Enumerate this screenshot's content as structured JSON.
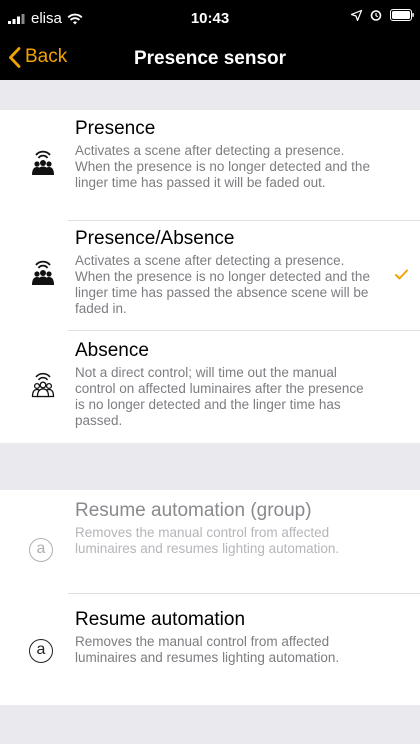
{
  "status_bar": {
    "carrier": "elisa",
    "time": "10:43"
  },
  "nav": {
    "back_label": "Back",
    "title": "Presence sensor"
  },
  "options": [
    {
      "title": "Presence",
      "description": "Activates a scene after detecting a presence. When the presence is no longer detected and the linger time has passed it will be faded out.",
      "icon": "presence-icon",
      "selected": false
    },
    {
      "title": "Presence/Absence",
      "description": "Activates a scene after detecting a presence. When the presence is no longer detected and the linger time has passed the absence scene will be faded in.",
      "icon": "presence-icon",
      "selected": true
    },
    {
      "title": "Absence",
      "description": "Not a direct control; will time out the manual control on affected luminaires after the presence is no longer detected and the linger time has passed.",
      "icon": "absence-icon",
      "selected": false
    }
  ],
  "actions": [
    {
      "title": "Resume automation (group)",
      "description": "Removes the manual control from affected luminaires and resumes lighting automation.",
      "icon_glyph": "a",
      "enabled": false
    },
    {
      "title": "Resume automation",
      "description": "Removes the manual control from affected luminaires and resumes lighting automation.",
      "icon_glyph": "a",
      "enabled": true
    }
  ],
  "colors": {
    "accent": "#f2a300",
    "background": "#efeff4",
    "bar": "#000000"
  }
}
